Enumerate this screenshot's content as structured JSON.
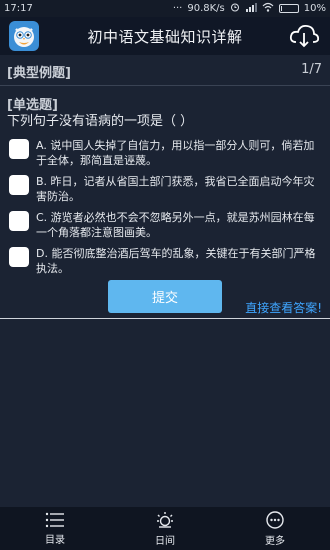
{
  "status_bar": {
    "time": "17:17",
    "network_speed": "90.8K/s",
    "battery": "10%",
    "battery_fraction": 0.1
  },
  "app_bar": {
    "title": "初中语文基础知识详解",
    "logo_icon": "owl-logo-icon",
    "right_icon": "cloud-download-icon"
  },
  "main": {
    "section_title": "[典型例题]",
    "page_indicator": "1/7",
    "question_type": "[单选题]",
    "question": "下列句子没有语病的一项是（    ）",
    "options": [
      {
        "label": "A. 说中国人失掉了自信力，用以指一部分人则可，倘若加于全体，那简直是诬蔑。"
      },
      {
        "label": "B. 昨日，记者从省国土部门获悉，我省已全面启动今年灾害防治。"
      },
      {
        "label": "C. 游览者必然也不会不忽略另外一点，就是苏州园林在每一个角落都注意图画美。"
      },
      {
        "label": "D. 能否彻底整治酒后驾车的乱象，关键在于有关部门严格执法。"
      }
    ],
    "submit_label": "提交",
    "answer_link": "直接查看答案!"
  },
  "bottom_nav": {
    "items": [
      {
        "label": "目录",
        "icon": "list-icon"
      },
      {
        "label": "日间",
        "icon": "sun-icon"
      },
      {
        "label": "更多",
        "icon": "more-icon"
      }
    ]
  }
}
